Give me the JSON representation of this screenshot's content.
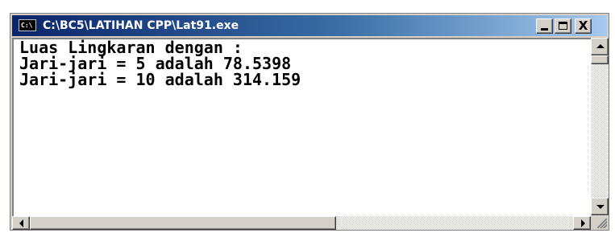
{
  "window": {
    "title": "C:\\BC5\\LATIHAN CPP\\Lat91.exe",
    "icon_label": "C:\\",
    "controls": {
      "minimize": "_",
      "maximize": "□",
      "close": "X"
    }
  },
  "console": {
    "lines": [
      "Luas Lingkaran dengan :",
      "Jari-jari = 5 adalah 78.5398",
      "Jari-jari = 10 adalah 314.159"
    ]
  },
  "icons": {
    "app": "console-app-icon",
    "scroll_up": "arrow-up-icon",
    "scroll_down": "arrow-down-icon",
    "scroll_left": "arrow-left-icon",
    "scroll_right": "arrow-right-icon",
    "resize": "resize-grip-icon"
  },
  "colors": {
    "titlebar_start": "#0a246a",
    "titlebar_end": "#a6caf0",
    "face": "#d4d0c8",
    "console_bg": "#ffffff",
    "console_text": "#000000"
  }
}
